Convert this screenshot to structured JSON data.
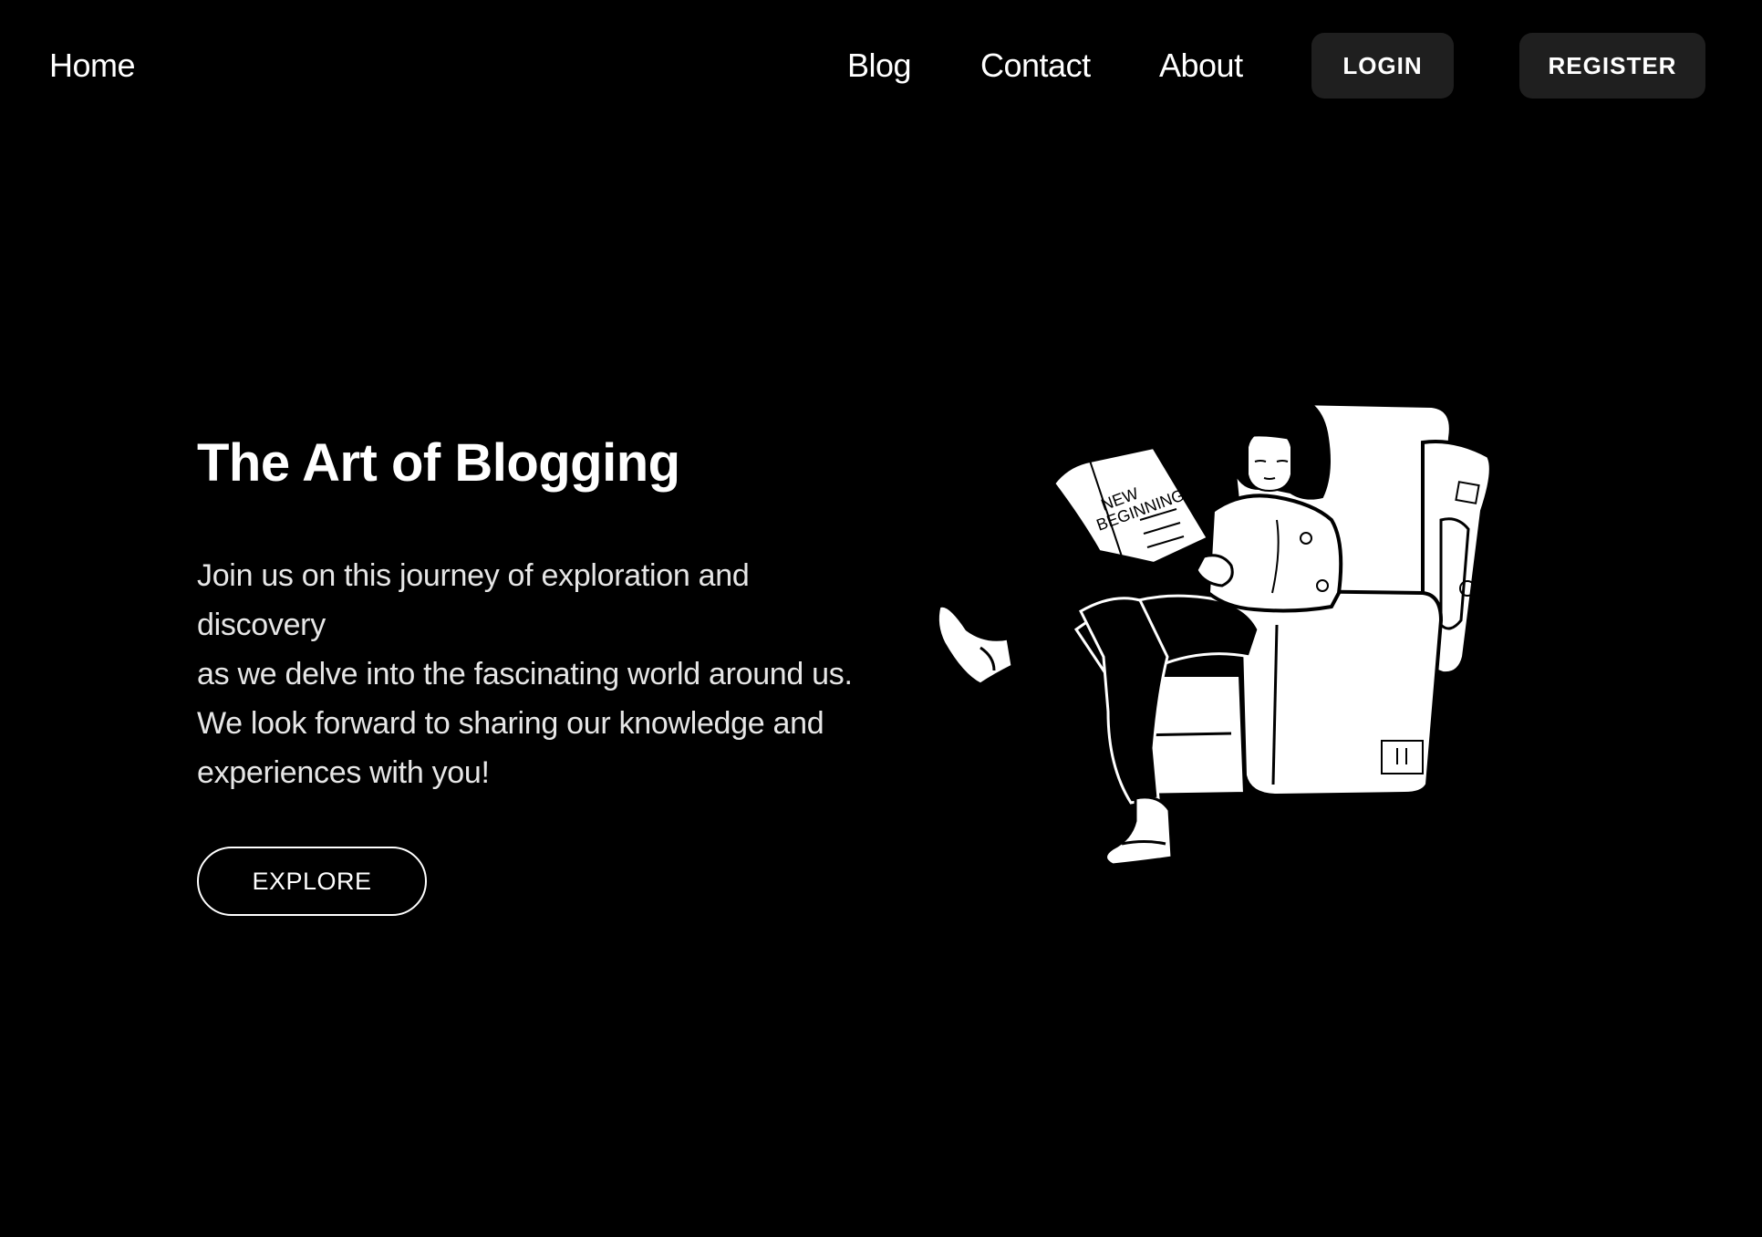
{
  "header": {
    "home_label": "Home",
    "nav": {
      "blog": "Blog",
      "contact": "Contact",
      "about": "About"
    },
    "login_label": "LOGIN",
    "register_label": "REGISTER"
  },
  "hero": {
    "title": "The Art of Blogging",
    "lines": [
      "Join us on this journey of exploration and",
      "discovery",
      "as we delve into the fascinating world around us.",
      "We look forward to sharing our knowledge and",
      "experiences with you!"
    ],
    "explore_label": "EXPLORE"
  },
  "illustration": {
    "icon": "person-reading-in-armchair-illustration",
    "newspaper_text": [
      "NEW",
      "BEGINNING"
    ]
  },
  "colors": {
    "background": "#000000",
    "text": "#ffffff",
    "nav_button_bg": "#1f1f1f"
  }
}
